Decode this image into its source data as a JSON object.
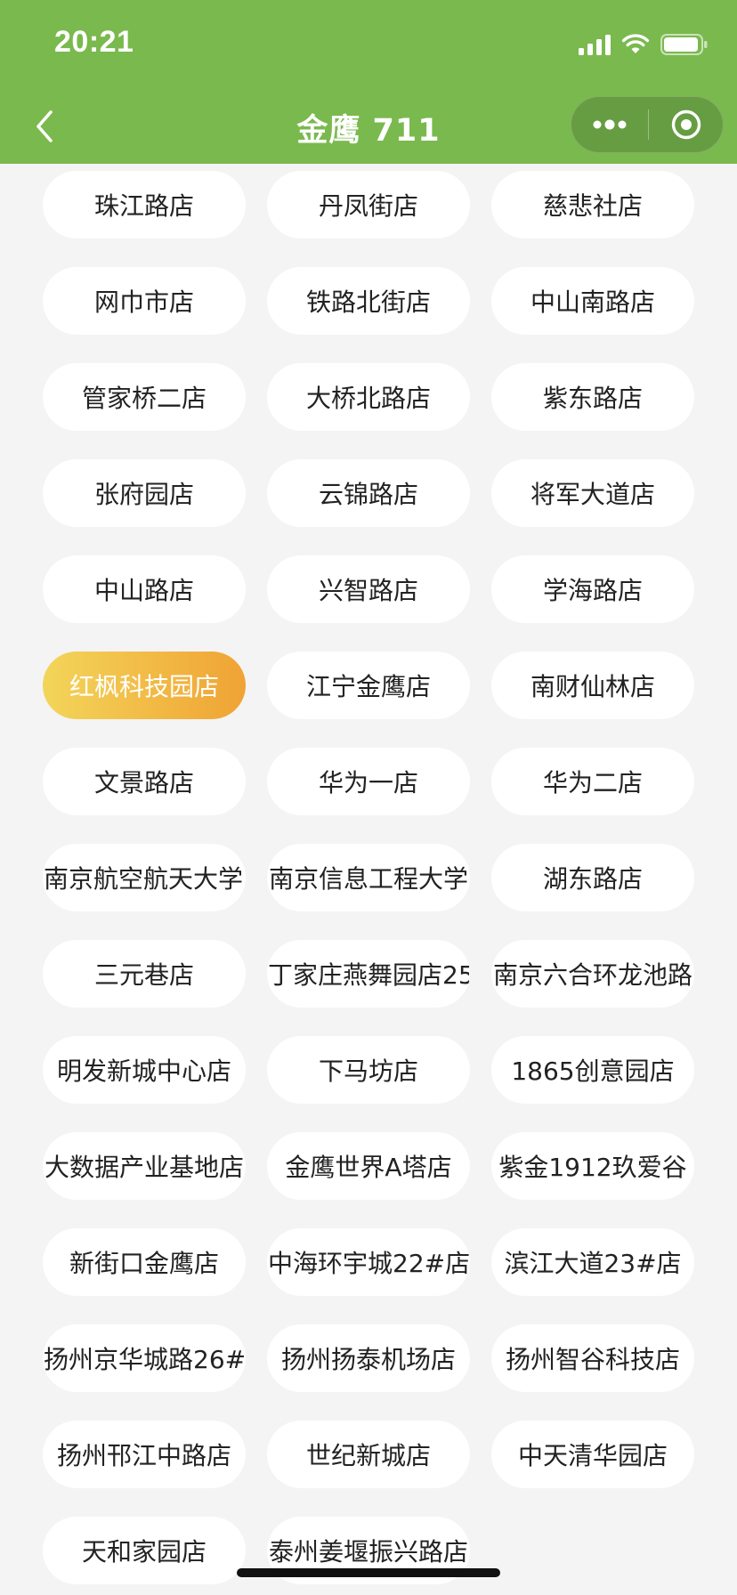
{
  "status_bar": {
    "time": "20:21"
  },
  "nav": {
    "title": "金鹰 711"
  },
  "icons": {
    "back": "chevron-left-icon",
    "more": "more-dots-icon",
    "close": "target-circle-icon"
  },
  "colors": {
    "header": "#7ab94e",
    "background": "#f4f4f4",
    "active_gradient_start": "#f3d55a",
    "active_gradient_end": "#f0a334"
  },
  "selected_store": "红枫科技园店",
  "stores": [
    "珠江路店",
    "丹凤街店",
    "慈悲社店",
    "网巾市店",
    "铁路北街店",
    "中山南路店",
    "管家桥二店",
    "大桥北路店",
    "紫东路店",
    "张府园店",
    "云锦路店",
    "将军大道店",
    "中山路店",
    "兴智路店",
    "学海路店",
    "红枫科技园店",
    "江宁金鹰店",
    "南财仙林店",
    "文景路店",
    "华为一店",
    "华为二店",
    "南京航空航天大学l",
    "南京信息工程大学",
    "湖东路店",
    "三元巷店",
    "丁家庄燕舞园店25",
    "南京六合环龙池路",
    "明发新城中心店",
    "下马坊店",
    "1865创意园店",
    "大数据产业基地店",
    "金鹰世界A塔店",
    "紫金1912玖爱谷",
    "新街口金鹰店",
    "中海环宇城22#店",
    "滨江大道23#店",
    "扬州京华城路26#",
    "扬州扬泰机场店",
    "扬州智谷科技店",
    "扬州邗江中路店",
    "世纪新城店",
    "中天清华园店",
    "天和家园店",
    "泰州姜堰振兴路店"
  ]
}
